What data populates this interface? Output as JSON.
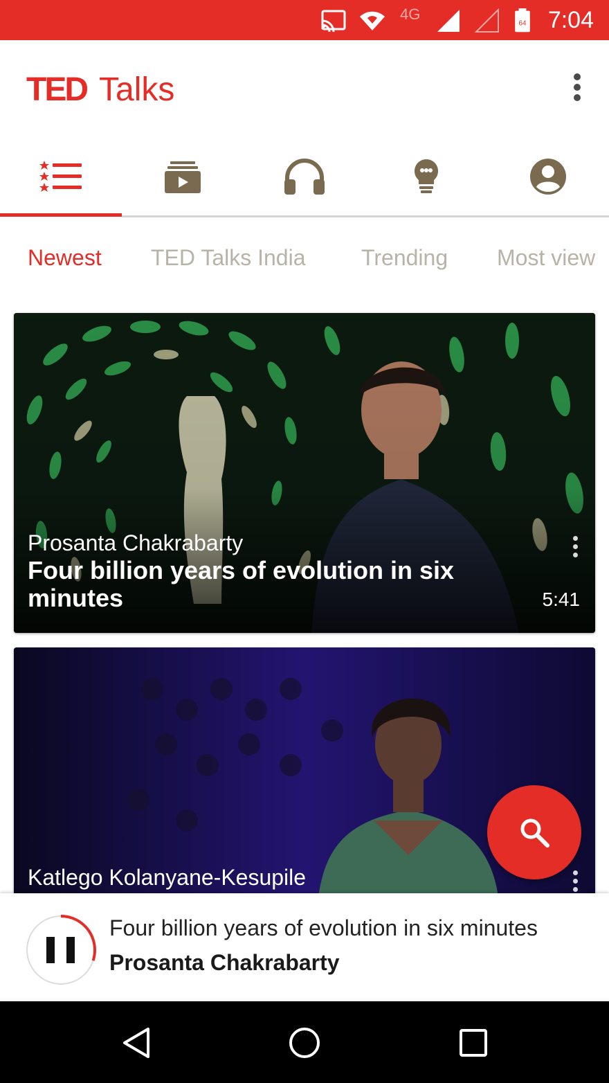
{
  "status_bar": {
    "time": "7:04",
    "network_label": "4G",
    "battery_label": "64",
    "icons": [
      "cast-icon",
      "wifi-icon",
      "signal-icon",
      "signal-empty-icon",
      "battery-icon"
    ],
    "background_color": "#e52d27"
  },
  "app_bar": {
    "logo_ted": "TED",
    "logo_talks": "Talks",
    "menu_icon": "more-vert-icon"
  },
  "icon_tabs": [
    {
      "icon": "talks-list-icon",
      "active": true
    },
    {
      "icon": "playlists-icon",
      "active": false
    },
    {
      "icon": "podcasts-headphones-icon",
      "active": false
    },
    {
      "icon": "surprise-me-lightbulb-icon",
      "active": false
    },
    {
      "icon": "my-talks-profile-icon",
      "active": false
    }
  ],
  "category_tabs": [
    {
      "label": "Newest",
      "active": true
    },
    {
      "label": "TED Talks India",
      "active": false
    },
    {
      "label": "Trending",
      "active": false
    },
    {
      "label": "Most view",
      "active": false
    }
  ],
  "talks": [
    {
      "speaker": "Prosanta Chakrabarty",
      "title": "Four billion years of evolution in six minutes",
      "duration": "5:41"
    },
    {
      "speaker": "Katlego Kolanyane-Kesupile",
      "title": "",
      "duration": ""
    }
  ],
  "fab": {
    "icon": "search-icon"
  },
  "now_playing": {
    "title": "Four billion years of evolution in six minutes",
    "speaker": "Prosanta Chakrabarty",
    "progress": 0.3,
    "state_icon": "pause-icon"
  },
  "nav_bar": {
    "buttons": [
      "back-icon",
      "home-icon",
      "recents-icon"
    ]
  },
  "colors": {
    "accent": "#e52d27",
    "inactive_icon": "#7a6a4f",
    "inactive_tab_text": "#b9b2a6"
  }
}
